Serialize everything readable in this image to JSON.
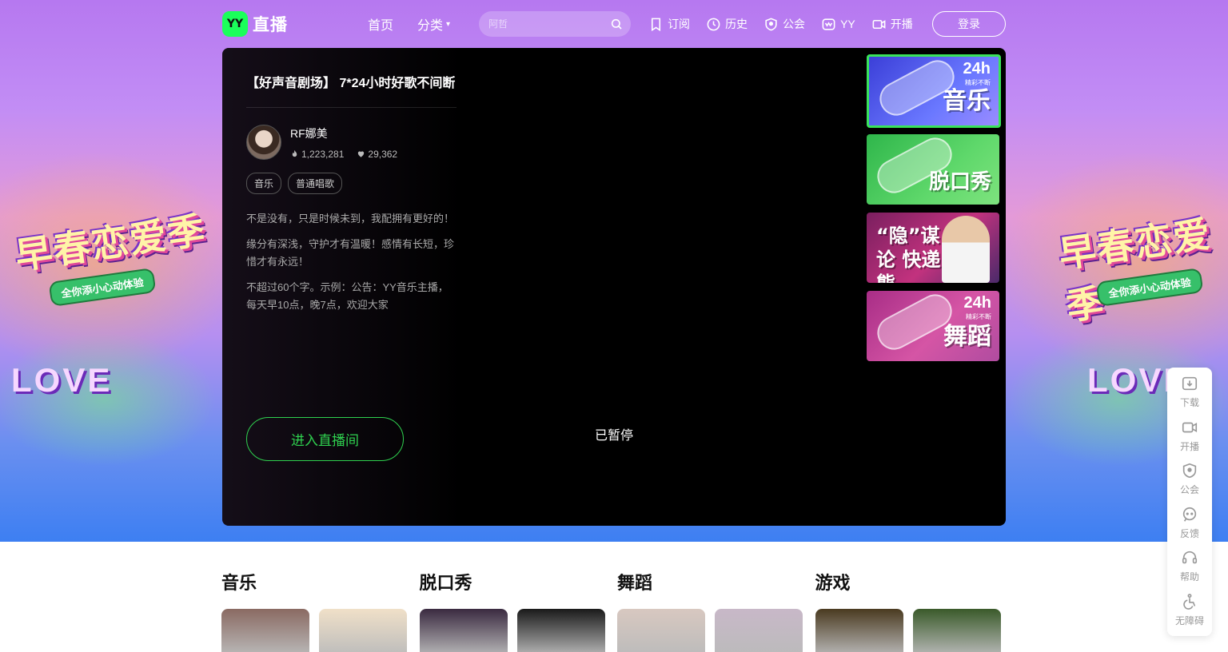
{
  "brand": {
    "badge": "YY",
    "name": "直播"
  },
  "nav": {
    "home": "首页",
    "category": "分类",
    "search_placeholder": "阿哲",
    "items": [
      "订阅",
      "历史",
      "公会",
      "YY",
      "开播"
    ],
    "login": "登录"
  },
  "hero": {
    "banner_title": "早春恋爱季",
    "banner_subtitle": "全你添小心动体验",
    "banner_love": "LOVE"
  },
  "room": {
    "title": "【好声音剧场】 7*24小时好歌不间断",
    "anchor_name": "RF娜美",
    "popularity": "1,223,281",
    "likes": "29,362",
    "tags": [
      "音乐",
      "普通唱歌"
    ],
    "desc": [
      "不是没有，只是时候未到，我配拥有更好的！",
      "缘分有深浅，守护才有温暖！感情有长短，珍惜才有永远！",
      "不超过60个字。示例：公告：YY音乐主播，每天早10点，晚7点，欢迎大家"
    ],
    "enter_button": "进入直播间",
    "status": "已暂停"
  },
  "thumbs": [
    {
      "label": "音乐",
      "badge": "24h",
      "badge_sub": "精彩不断",
      "active": true
    },
    {
      "label": "脱口秀",
      "badge": "",
      "badge_sub": "",
      "active": false
    },
    {
      "label": "“隐”谋论 快递熊",
      "badge": "",
      "badge_sub": "",
      "active": false
    },
    {
      "label": "舞蹈",
      "badge": "24h",
      "badge_sub": "精彩不断",
      "active": false
    }
  ],
  "siderail": [
    "下载",
    "开播",
    "公会",
    "反馈",
    "帮助",
    "无障碍"
  ],
  "categories": [
    {
      "title": "音乐",
      "cards": [
        "#8a6a62",
        "#f0e0c8"
      ]
    },
    {
      "title": "脱口秀",
      "cards": [
        "#3a2a40",
        "#1a1a1a"
      ]
    },
    {
      "title": "舞蹈",
      "cards": [
        "#d8c8c0",
        "#c8b8c8"
      ]
    },
    {
      "title": "游戏",
      "cards": [
        "#4a3a20",
        "#3a5a2a"
      ]
    }
  ],
  "colors": {
    "accent_green": "#2fd14f",
    "thumb_active_border": "#39e35a"
  }
}
